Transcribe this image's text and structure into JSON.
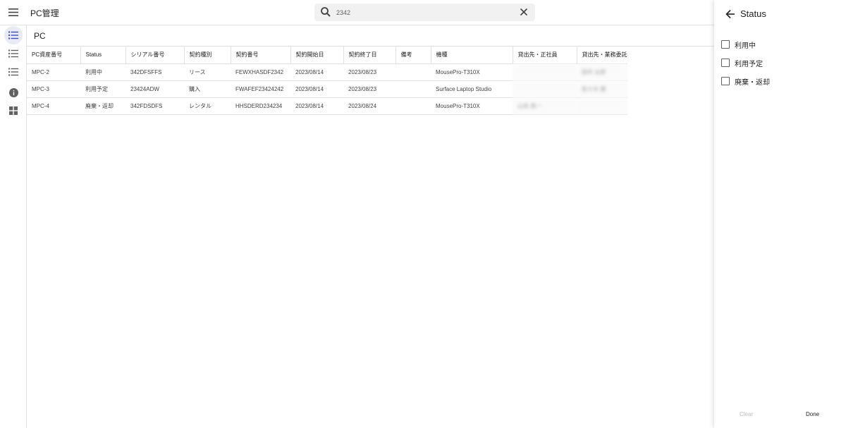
{
  "app": {
    "title": "PC管理"
  },
  "search": {
    "value": "2342"
  },
  "page": {
    "title": "PC"
  },
  "table": {
    "columns": [
      "PC資産番号",
      "Status",
      "シリアル番号",
      "契約種別",
      "契約番号",
      "契約開始日",
      "契約終了日",
      "備考",
      "機種",
      "貸出先・正社員",
      "貸出先・業務委託"
    ],
    "rows": [
      [
        "MPC-2",
        "利用中",
        "342DFSFFS",
        "リース",
        "FEWXHASDF2342",
        "2023/08/14",
        "2023/08/23",
        "",
        "MousePro-T310X",
        "",
        "田中 太郎"
      ],
      [
        "MPC-3",
        "利用予定",
        "23424ADW",
        "購入",
        "FWAFEF23424242",
        "2023/08/14",
        "2023/08/23",
        "",
        "Surface Laptop Studio",
        "",
        "佐々木 健"
      ],
      [
        "MPC-4",
        "廃棄・返却",
        "342FDSDFS",
        "レンタル",
        "HHSDERD234234",
        "2023/08/14",
        "2023/08/24",
        "",
        "MousePro-T310X",
        "山本 真一",
        ""
      ]
    ]
  },
  "filter_panel": {
    "title": "Status",
    "options": [
      {
        "label": "利用中",
        "checked": false
      },
      {
        "label": "利用予定",
        "checked": false
      },
      {
        "label": "廃棄・返却",
        "checked": false
      }
    ],
    "clear_label": "Clear",
    "done_label": "Done"
  },
  "icons": {
    "menu": "menu-icon",
    "search": "search-icon",
    "clear": "close-icon",
    "back": "arrow-back-icon",
    "rail": [
      "list-icon",
      "list-icon",
      "list-icon",
      "info-icon",
      "dashboard-icon"
    ]
  },
  "colors": {
    "accent": "#3f51b5",
    "rail_active_bg": "#e8eaf6",
    "border": "#e0e0e0"
  }
}
